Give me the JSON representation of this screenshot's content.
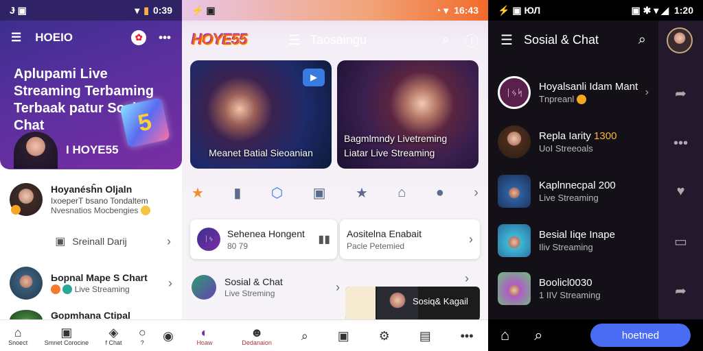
{
  "panel1": {
    "status": {
      "left": "Ɉ ▣",
      "time": "0:39"
    },
    "header": {
      "title": "HOEIO"
    },
    "hero": {
      "title": "Aplupami Live Streaming Terbaming Terbaak patur Sosial & Chat",
      "brand": "I HOYE55",
      "cube_glyph": "5"
    },
    "list": [
      {
        "title": "Hoyanésĥn Oljaln",
        "line2": "IxoeperT bsano Tondaltem",
        "line3": "Nvesnatios Mocbengies"
      },
      {
        "center": "Sreinall Darij"
      },
      {
        "title": "Ьopnal Mape S Chart",
        "line2": "Live Streaming"
      },
      {
        "title": "Ǥopmhana Ctipal"
      }
    ],
    "nav": [
      {
        "icon": "home-icon",
        "glyph": "⌂",
        "label": "Snoect"
      },
      {
        "icon": "chat-icon",
        "glyph": "▣",
        "label": "Smnet Corocine"
      },
      {
        "icon": "gift-icon",
        "glyph": "◈",
        "label": "f Chat"
      },
      {
        "icon": "profile-icon",
        "glyph": "○",
        "label": "?"
      },
      {
        "icon": "more-icon",
        "glyph": "◉",
        "label": ""
      }
    ]
  },
  "panel2": {
    "status": {
      "left": "⚡ ▣",
      "time": "16:43"
    },
    "header": {
      "logo": "HOYE55",
      "title": "Taosaingu"
    },
    "cards": [
      {
        "caption": "Meanet Batial Sieoanian"
      },
      {
        "caption": "Bagmlmndy Livetreming Liatar Live Streaming"
      }
    ],
    "icons": [
      "★",
      "▮",
      "⬡",
      "▣",
      "★",
      "⌂",
      "●",
      "›"
    ],
    "boxes": [
      {
        "title": "Sehenea Hongent",
        "sub": "80 79"
      },
      {
        "title": "Aositelna Enabait",
        "sub": "Pacle Petemied"
      }
    ],
    "list": [
      {
        "title": "Sosial & Chat",
        "sub": "Live Streming"
      }
    ],
    "promo": {
      "title": "Sosiq& Kagail"
    },
    "nav": [
      {
        "icon": "avatar-icon",
        "glyph": "◐",
        "label": "Hoaw"
      },
      {
        "icon": "profile-icon",
        "glyph": "☻",
        "label": "Dedanaion"
      },
      {
        "icon": "search-icon",
        "glyph": "⌕",
        "label": ""
      },
      {
        "icon": "camera-icon",
        "glyph": "▣",
        "label": ""
      },
      {
        "icon": "settings-icon",
        "glyph": "⚙",
        "label": ""
      },
      {
        "icon": "gift-icon",
        "glyph": "▤",
        "label": ""
      },
      {
        "icon": "more-icon",
        "glyph": "•••",
        "label": ""
      }
    ]
  },
  "panel3": {
    "status": {
      "left": "⚡ ▣ ЮЛ",
      "time": "1:20"
    },
    "header": {
      "title": "Sosial & Chat"
    },
    "rows": [
      {
        "title": "Hoyalsanli Idam Mant",
        "sub": "Tnpreanl",
        "accent": "",
        "logo_text": "ᛁᛃᛋ"
      },
      {
        "title": "Repla Iarity ",
        "accent": "1300",
        "sub": "UoI Streeoals"
      },
      {
        "title": "",
        "accent": "Kaplnnecpal 200",
        "sub": "Live Streaming"
      },
      {
        "title": "Besial Iiqe Inape",
        "accent": "",
        "sub": "Iliv Streaming"
      },
      {
        "title": "",
        "accent": "Boolicl0030",
        "sub": "1 IIV Streaming"
      }
    ],
    "send_label": "hoetned"
  }
}
